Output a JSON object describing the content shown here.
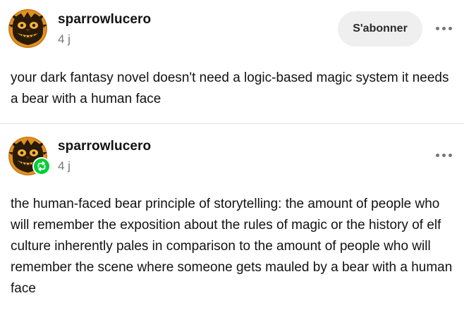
{
  "posts": [
    {
      "username": "sparrowlucero",
      "timestamp": "4 j",
      "follow_label": "S'abonner",
      "more_icon": "ellipsis-icon",
      "avatar_icon": "monster-face-avatar",
      "body": "your dark fantasy novel doesn't need a logic-based magic system it needs a bear with a human face"
    },
    {
      "username": "sparrowlucero",
      "timestamp": "4 j",
      "more_icon": "ellipsis-icon",
      "avatar_icon": "monster-face-avatar",
      "badge_icon": "reblog-icon",
      "body": "the human-faced bear principle of storytelling: the amount of people who will remember the exposition about the rules of magic or the history of elf culture inherently pales in comparison to the amount of people who will remember the scene where someone gets mauled by a bear with a human face"
    }
  ],
  "colors": {
    "text": "#121212",
    "muted": "#777777",
    "button_bg": "#efefef",
    "reblog_green": "#00cf35",
    "avatar_orange": "#e8891e",
    "avatar_dark": "#2a1a08"
  }
}
